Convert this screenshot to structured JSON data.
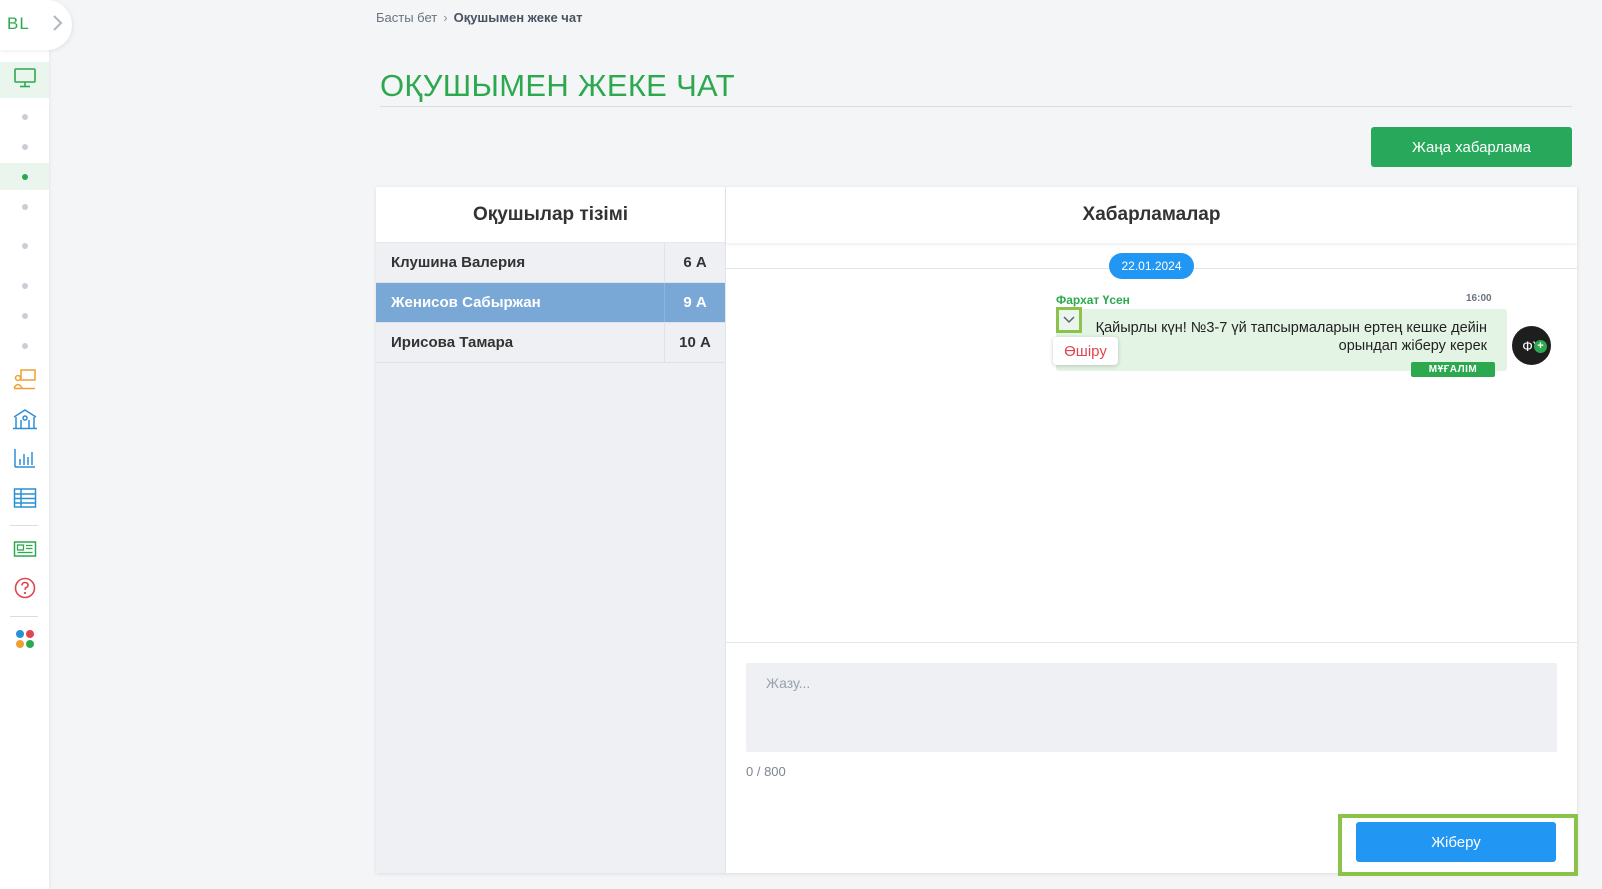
{
  "logo": {
    "text": "BL"
  },
  "breadcrumb": {
    "home": "Басты бет",
    "separator": "›",
    "current": "Оқушымен жеке чат"
  },
  "page": {
    "title": "ОҚУШЫМЕН ЖЕКЕ ЧАТ",
    "new_message_button": "Жаңа хабарлама"
  },
  "students": {
    "header": "Оқушылар тізімі",
    "rows": [
      {
        "name": "Клушина Валерия",
        "class": "6 А",
        "selected": false
      },
      {
        "name": "Женисов Сабыржан",
        "class": "9 А",
        "selected": true
      },
      {
        "name": "Ирисова Тамара",
        "class": "10 А",
        "selected": false
      }
    ]
  },
  "messages": {
    "header": "Хабарламалар",
    "date": "22.01.2024",
    "items": [
      {
        "sender": "Фархат Үсен",
        "time": "16:00",
        "text": "Қайырлы күн! №3-7 үй тапсырмаларын ертең кешке дейін орындап жіберу керек",
        "role": "МҰҒАЛІМ",
        "avatar_initials": "ФҮ",
        "delete_label": "Өшіру"
      }
    ]
  },
  "composer": {
    "placeholder": "Жазу...",
    "value": "",
    "counter": "0 / 800",
    "send_label": "Жіберу"
  },
  "colors": {
    "brand_green": "#2ca94f",
    "selected_row": "#7aa8d6",
    "send_blue": "#2196f3",
    "delete_red": "#e0454f",
    "highlight": "#8bc34a"
  }
}
